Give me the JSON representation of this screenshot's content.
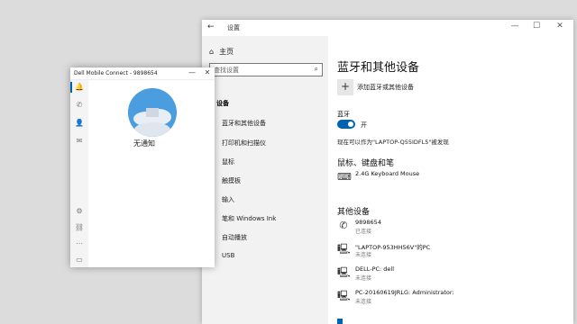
{
  "settings": {
    "title": "设置",
    "search_placeholder": "查找设置",
    "home_label": "主页",
    "section_label": "设备",
    "nav": [
      "蓝牙和其他设备",
      "打印机和扫描仪",
      "鼠标",
      "触摸板",
      "输入",
      "笔和 Windows Ink",
      "自动播放",
      "USB"
    ],
    "heading": "蓝牙和其他设备",
    "add_device_label": "添加蓝牙或其他设备",
    "bluetooth_label": "蓝牙",
    "bluetooth_state": "开",
    "discoverable_text": "现在可以作为\"LAPTOP-Q55IDFL5\"被发现",
    "mouse_heading": "鼠标、键盘和笔",
    "mouse_devices": [
      {
        "name": "2.4G Keyboard Mouse",
        "status": "",
        "icon": "keyboard-icon"
      }
    ],
    "other_heading": "其他设备",
    "other_devices": [
      {
        "name": "9898654",
        "status": "已连接",
        "icon": "phone-icon"
      },
      {
        "name": "\"LAPTOP-953HH56V\"的PC",
        "status": "未连接",
        "icon": "pc-icon"
      },
      {
        "name": "DELL-PC: dell",
        "status": "未连接",
        "icon": "pc-icon"
      },
      {
        "name": "PC-20160619JRLG: Administrator:",
        "status": "未连接",
        "icon": "pc-icon"
      }
    ],
    "controls": {
      "minimize": "—",
      "maximize": "☐",
      "close": "✕"
    }
  },
  "dell": {
    "title": "Dell Mobile Connect - 9898654",
    "no_notifications": "无通知",
    "controls": {
      "minimize": "—",
      "close": "✕"
    }
  },
  "colors": {
    "accent": "#0063b1",
    "avatar_bg": "#4a9ee0"
  }
}
